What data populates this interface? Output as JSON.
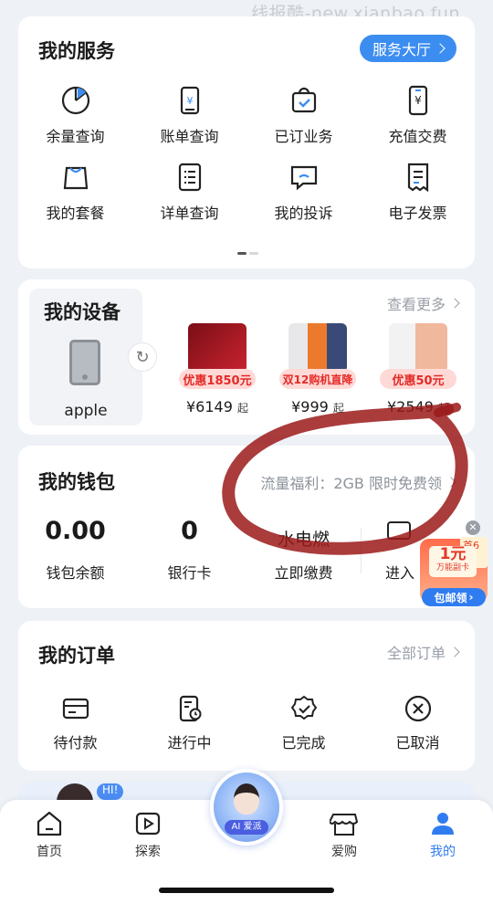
{
  "watermark": "线报酷-new.xianbao.fun",
  "services": {
    "title": "我的服务",
    "hall_button": "服务大厅",
    "items": [
      {
        "label": "余量查询",
        "icon": "pie-chart-icon"
      },
      {
        "label": "账单查询",
        "icon": "bill-icon"
      },
      {
        "label": "已订业务",
        "icon": "bag-check-icon"
      },
      {
        "label": "充值交费",
        "icon": "phone-yen-icon"
      },
      {
        "label": "我的套餐",
        "icon": "package-bag-icon"
      },
      {
        "label": "详单查询",
        "icon": "list-doc-icon"
      },
      {
        "label": "我的投诉",
        "icon": "complaint-chat-icon"
      },
      {
        "label": "电子发票",
        "icon": "invoice-icon"
      }
    ]
  },
  "devices": {
    "title": "我的设备",
    "more": "查看更多",
    "my_device_name": "apple",
    "products": [
      {
        "badge": "优惠1850元",
        "price": "¥6149",
        "suffix": "起",
        "color": "#b81f2a"
      },
      {
        "badge": "双12购机直降",
        "price": "¥999",
        "suffix": "起",
        "color": "#e8762c"
      },
      {
        "badge": "优惠50元",
        "price": "¥2549",
        "suffix": "起",
        "color": "#f1b79c"
      }
    ]
  },
  "wallet": {
    "title": "我的钱包",
    "promo": "流量福利：2GB 限时免费领",
    "items": [
      {
        "value": "0.00",
        "label": "钱包余额"
      },
      {
        "value": "0",
        "label": "银行卡"
      },
      {
        "value": "水电燃",
        "label": "立即缴费"
      },
      {
        "value": "",
        "label": "进入"
      }
    ]
  },
  "float_ad": {
    "tag": "首6月",
    "main": "1元",
    "sub": "万能副卡",
    "button": "包邮领"
  },
  "orders": {
    "title": "我的订单",
    "more": "全部订单",
    "items": [
      {
        "label": "待付款",
        "icon": "wallet-card-icon"
      },
      {
        "label": "进行中",
        "icon": "clock-doc-icon"
      },
      {
        "label": "已完成",
        "icon": "badge-check-icon"
      },
      {
        "label": "已取消",
        "icon": "circle-x-icon"
      }
    ]
  },
  "banner": {
    "hi": "HI!"
  },
  "tabbar": {
    "items": [
      {
        "label": "首页",
        "icon": "home-icon"
      },
      {
        "label": "探索",
        "icon": "play-icon"
      },
      {
        "label": "爱购",
        "icon": "shop-icon"
      },
      {
        "label": "我的",
        "icon": "user-icon"
      }
    ],
    "ai_label": "AI 爱派"
  },
  "colors": {
    "accent": "#2f7cf0",
    "scribble": "#9b1a1a"
  }
}
